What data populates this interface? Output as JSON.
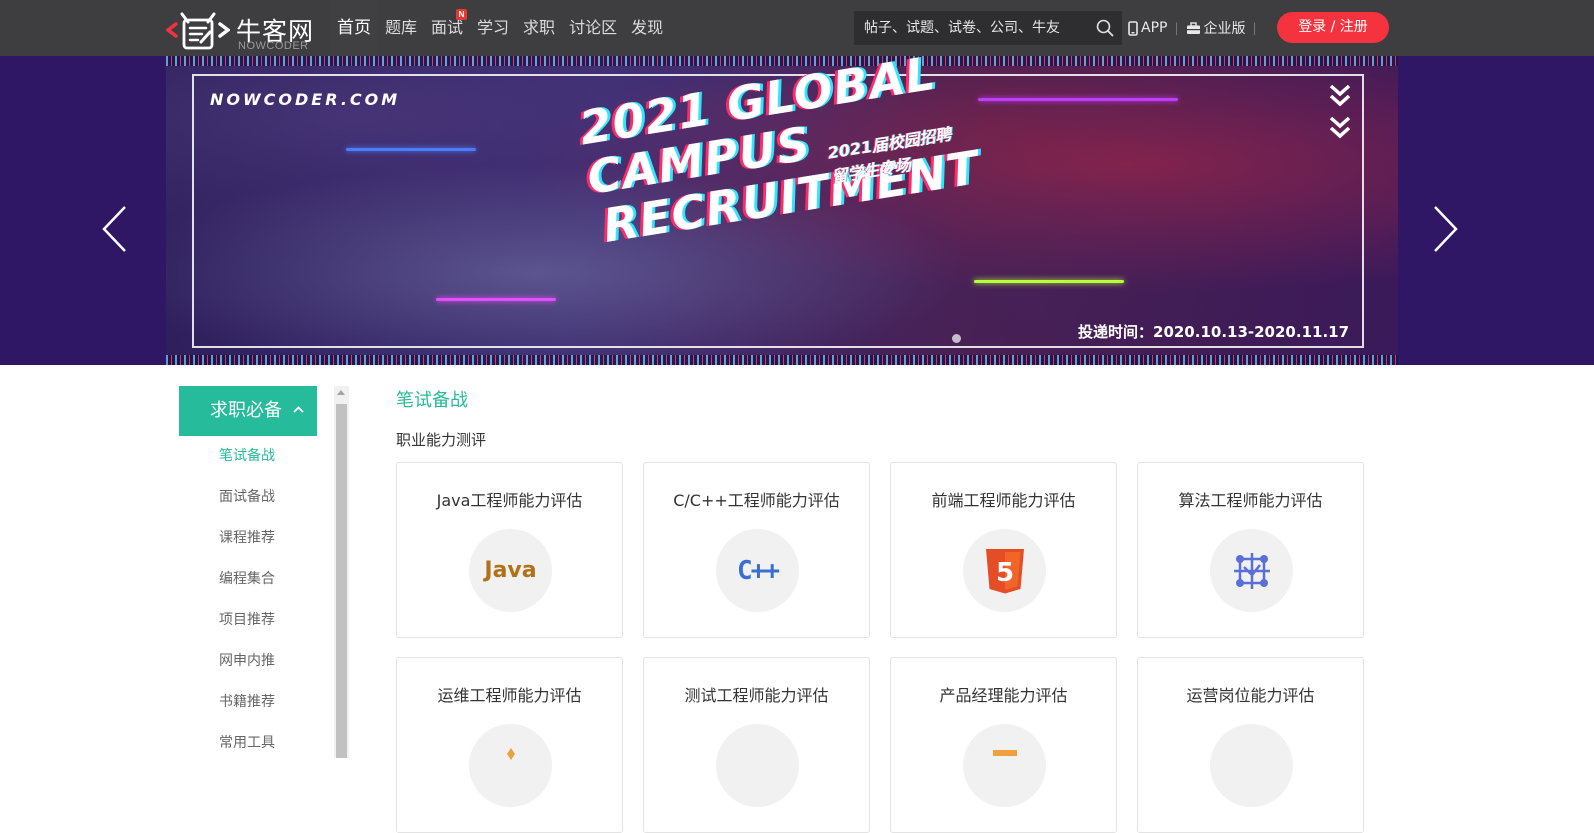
{
  "header": {
    "logo_cn": "牛客网",
    "logo_en": "NOWCODER",
    "nav": [
      {
        "label": "首页",
        "active": true,
        "badge": ""
      },
      {
        "label": "题库",
        "active": false,
        "badge": ""
      },
      {
        "label": "面试",
        "active": false,
        "badge": "N"
      },
      {
        "label": "学习",
        "active": false,
        "badge": ""
      },
      {
        "label": "求职",
        "active": false,
        "badge": ""
      },
      {
        "label": "讨论区",
        "active": false,
        "badge": ""
      },
      {
        "label": "发现",
        "active": false,
        "badge": ""
      }
    ],
    "search_placeholder": "帖子、试题、试卷、公司、牛友",
    "app_label": "APP",
    "enterprise_label": "企业版",
    "login_label": "登录 / 注册"
  },
  "banner": {
    "brand": "NOWCODER.COM",
    "headline_1": "2021 GLOBAL",
    "headline_2": "CAMPUS",
    "headline_3": "RECRUITMENT",
    "sub_1": "2021届校园招聘",
    "sub_2": "留学生专场",
    "date_text": "投递时间：2020.10.13-2020.11.17"
  },
  "sidebar": {
    "heading": "求职必备",
    "items": [
      {
        "label": "笔试备战",
        "active": true
      },
      {
        "label": "面试备战",
        "active": false
      },
      {
        "label": "课程推荐",
        "active": false
      },
      {
        "label": "编程集合",
        "active": false
      },
      {
        "label": "项目推荐",
        "active": false
      },
      {
        "label": "网申内推",
        "active": false
      },
      {
        "label": "书籍推荐",
        "active": false
      },
      {
        "label": "常用工具",
        "active": false
      }
    ]
  },
  "main": {
    "section_title": "笔试备战",
    "section_subtitle": "职业能力测评",
    "cards": [
      {
        "title": "Java工程师能力评估",
        "icon": "java-icon",
        "icon_text": "Java"
      },
      {
        "title": "C/C++工程师能力评估",
        "icon": "cpp-icon",
        "icon_text": "C++"
      },
      {
        "title": "前端工程师能力评估",
        "icon": "html5-icon",
        "icon_text": "5"
      },
      {
        "title": "算法工程师能力评估",
        "icon": "algorithm-icon",
        "icon_text": ""
      },
      {
        "title": "运维工程师能力评估",
        "icon": "ops-icon",
        "icon_text": ""
      },
      {
        "title": "测试工程师能力评估",
        "icon": "test-icon",
        "icon_text": ""
      },
      {
        "title": "产品经理能力评估",
        "icon": "product-icon",
        "icon_text": ""
      },
      {
        "title": "运营岗位能力评估",
        "icon": "operations-icon",
        "icon_text": ""
      }
    ]
  },
  "colors": {
    "accent": "#25bb9b",
    "topbar": "#3e3e40",
    "login": "#f5333f",
    "banner_bg": "#2f1766"
  }
}
